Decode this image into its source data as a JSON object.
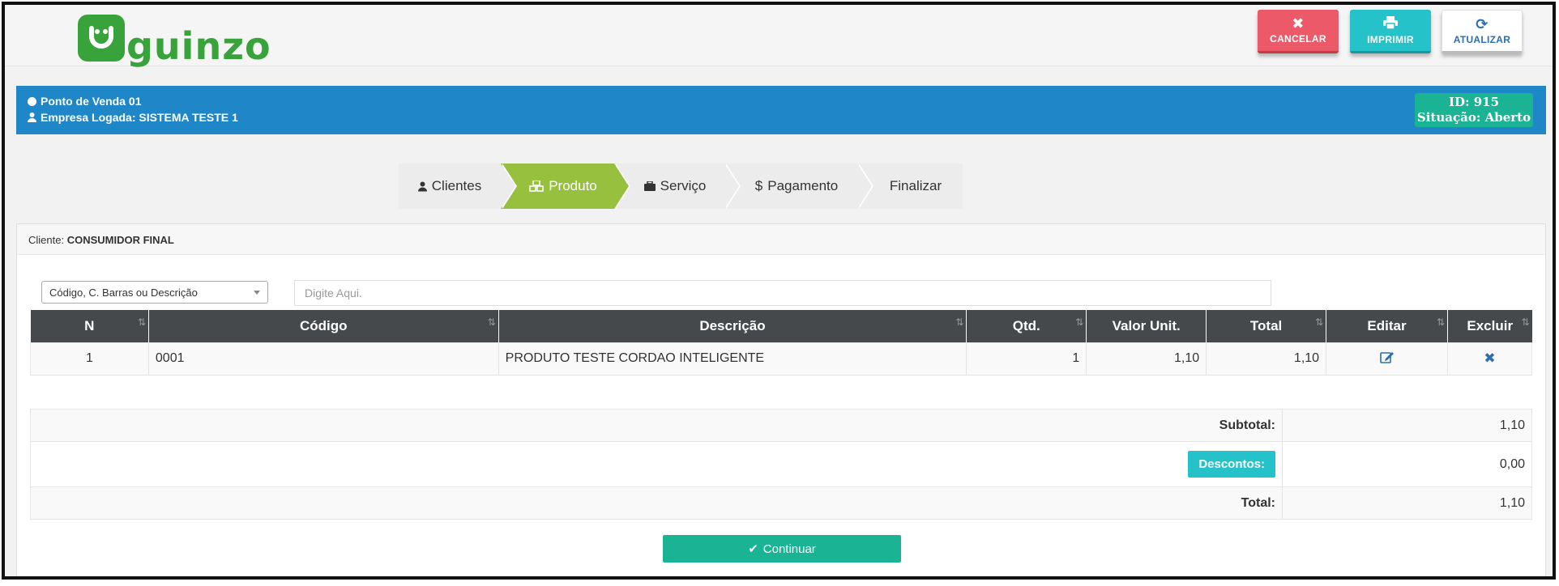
{
  "header": {
    "logo_text": "guinzo",
    "buttons": {
      "cancel": "CANCELAR",
      "print": "IMPRIMIR",
      "refresh": "ATUALIZAR"
    }
  },
  "infobar": {
    "pdv": "Ponto de Venda 01",
    "empresa": "Empresa Logada: SISTEMA TESTE 1",
    "id": "ID: 915",
    "situacao": "Situação: Aberto"
  },
  "steps": [
    {
      "label": "Clientes",
      "icon": "user-icon"
    },
    {
      "label": "Produto",
      "icon": "cubes-icon",
      "active": true
    },
    {
      "label": "Serviço",
      "icon": "briefcase-icon"
    },
    {
      "label": "Pagamento",
      "icon": "dollar-icon"
    },
    {
      "label": "Finalizar"
    }
  ],
  "client": {
    "label": "Cliente:",
    "name": "CONSUMIDOR FINAL"
  },
  "search": {
    "select_value": "Código, C. Barras ou Descrição",
    "placeholder": "Digite Aqui."
  },
  "table": {
    "headers": [
      "N",
      "Código",
      "Descrição",
      "Qtd.",
      "Valor Unit.",
      "Total",
      "Editar",
      "Excluir"
    ],
    "rows": [
      {
        "n": "1",
        "codigo": "0001",
        "descricao": "PRODUTO TESTE CORDAO INTELIGENTE",
        "qtd": "1",
        "valor_unit": "1,10",
        "total": "1,10"
      }
    ]
  },
  "totals": {
    "subtotal_label": "Subtotal:",
    "subtotal_value": "1,10",
    "descontos_label": "Descontos:",
    "descontos_value": "0,00",
    "total_label": "Total:",
    "total_value": "1,10"
  },
  "continue_label": "Continuar",
  "colors": {
    "brand_green": "#38a33a",
    "info_blue": "#1f86c8",
    "teal": "#1ab394",
    "active_step": "#98c03f",
    "cancel_red": "#ec5a69",
    "cyan": "#25c2c9"
  }
}
